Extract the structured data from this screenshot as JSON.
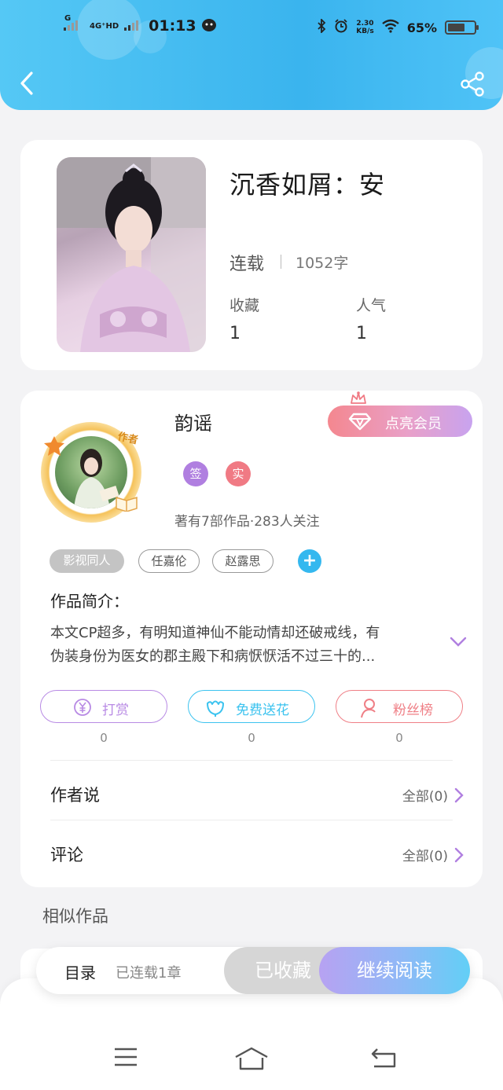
{
  "status_bar": {
    "network1": "G",
    "network2": "4G⁺HD",
    "time": "01:13",
    "speed_value": "2.30",
    "speed_unit": "KB/s",
    "battery": "65%",
    "battery_level": 0.65
  },
  "book": {
    "title": "沉香如屑：安",
    "status": "连载",
    "words": "1052字",
    "stats": [
      {
        "label": "收藏",
        "value": "1"
      },
      {
        "label": "人气",
        "value": "1"
      }
    ]
  },
  "author": {
    "avatar_tag": "作者",
    "name": "韵谣",
    "badges": [
      {
        "label": "签",
        "color": "#b07fe0"
      },
      {
        "label": "实",
        "color": "#f07a84"
      }
    ],
    "meta": "著有7部作品·283人关注",
    "vip_label": "点亮会员"
  },
  "tags": [
    "影视同人",
    "任嘉伦",
    "赵露思"
  ],
  "intro": {
    "title": "作品简介：",
    "line1": "本文CP超多，有明知道神仙不能动情却还破戒线，有",
    "line2": "伪装身份为医女的郡主殿下和病恹恹活不过三十的..."
  },
  "actions": [
    {
      "label": "打赏",
      "count": "0",
      "color": "#b88ae4"
    },
    {
      "label": "免费送花",
      "count": "0",
      "color": "#3cc3ef"
    },
    {
      "label": "粉丝榜",
      "count": "0",
      "color": "#ef7f86"
    }
  ],
  "rows": [
    {
      "title": "作者说",
      "link": "全部(0)"
    },
    {
      "title": "评论",
      "link": "全部(0)"
    }
  ],
  "similar_title": "相似作品",
  "bottom_bar": {
    "toc": "目录",
    "toc_sub": "已连载1章",
    "favorited": "已收藏",
    "continue": "继续阅读"
  },
  "colors": {
    "header_blue": "#3ab4ee",
    "accent_purple": "#b07fe0",
    "accent_pink": "#f07a84",
    "accent_cyan": "#3cc3ef"
  }
}
